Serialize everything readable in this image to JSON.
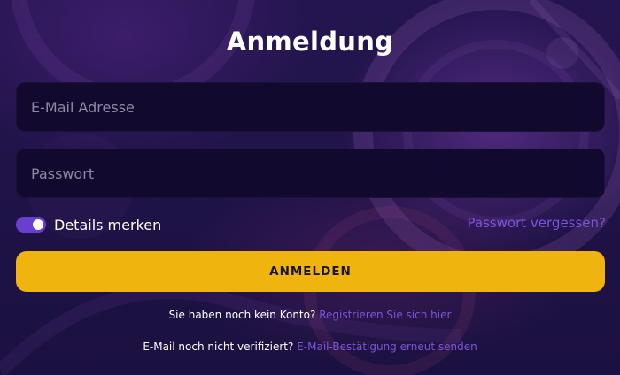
{
  "form": {
    "title": "Anmeldung",
    "email_placeholder": "E-Mail Adresse",
    "password_placeholder": "Passwort",
    "remember_label": "Details merken",
    "remember_checked": true,
    "forgot_link": "Passwort vergessen?",
    "submit_label": "ANMELDEN",
    "register_prompt": "Sie haben noch kein Konto?",
    "register_link": "Registrieren Sie sich hier",
    "verify_prompt": "E-Mail noch nicht verifiziert?",
    "verify_link": "E-Mail-Bestätigung erneut senden"
  },
  "colors": {
    "background": "#1d1240",
    "input_background": "#120a2e",
    "accent": "#f0b40e",
    "link": "#7c55d8",
    "toggle": "#6a3fd0"
  }
}
